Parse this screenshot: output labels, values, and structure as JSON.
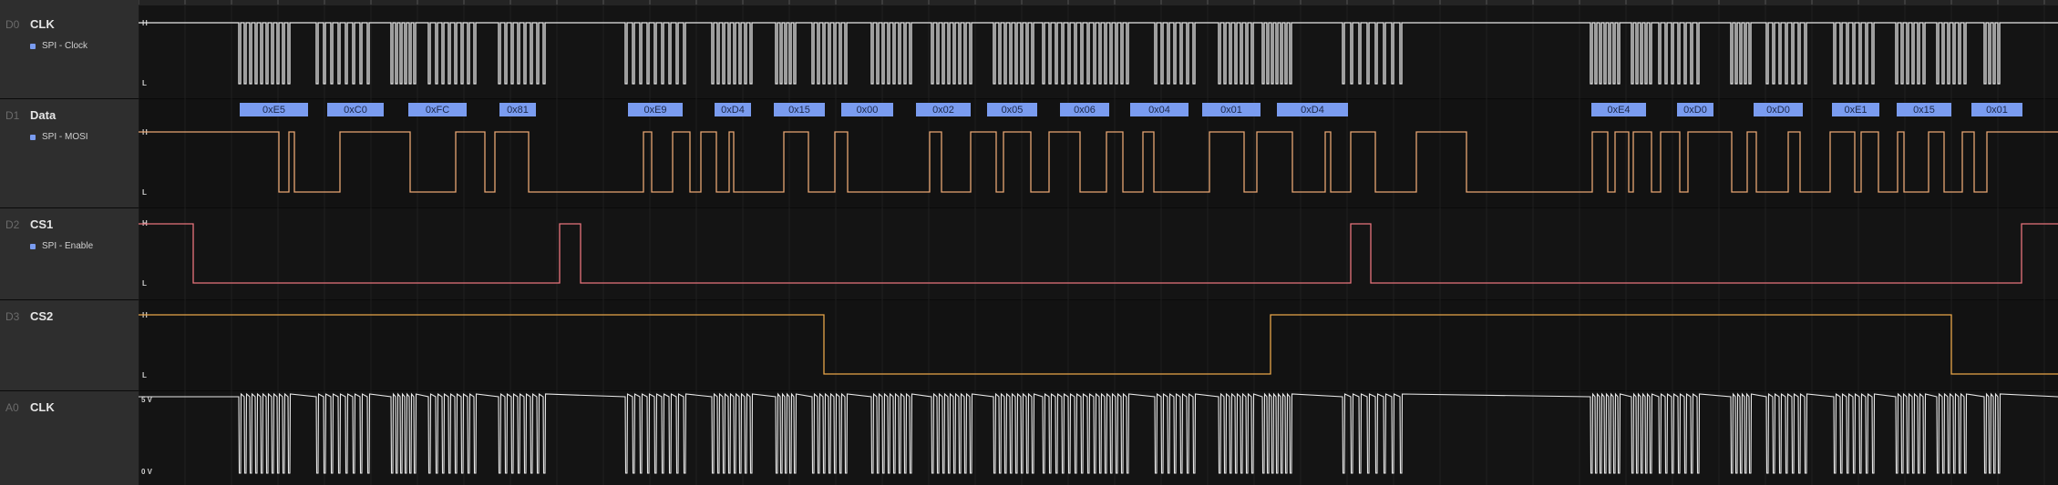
{
  "colors": {
    "clock": "#e8e8e8",
    "mosi": "#e8a673",
    "cs1": "#e8737c",
    "cs2": "#e8a54a",
    "decode_box": "#7a9cf0",
    "decode_text": "#1b2748"
  },
  "channels": [
    {
      "id": "D0",
      "name": "CLK",
      "annotation": "SPI - Clock",
      "level_high": "H",
      "level_low": "L"
    },
    {
      "id": "D1",
      "name": "Data",
      "annotation": "SPI - MOSI",
      "level_high": "H",
      "level_low": "L"
    },
    {
      "id": "D2",
      "name": "CS1",
      "annotation": "SPI - Enable",
      "level_high": "H",
      "level_low": "L"
    },
    {
      "id": "D3",
      "name": "CS2",
      "annotation": "",
      "level_high": "H",
      "level_low": "L"
    },
    {
      "id": "A0",
      "name": "CLK",
      "annotation": "",
      "level_high": "5 V",
      "level_low": "0 V"
    }
  ],
  "decoded_bytes": [
    "0xE5",
    "0xC0",
    "0xFC",
    "0x81",
    "0xE9",
    "0xD4",
    "0x15",
    "0x00",
    "0x02",
    "0x05",
    "0x06",
    "0x04",
    "0x01",
    "0xD4",
    "0xE4",
    "0xD0",
    "0xD0",
    "0xE1",
    "0x15",
    "0x01"
  ]
}
